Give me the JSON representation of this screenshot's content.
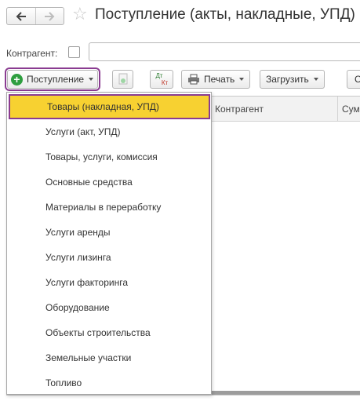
{
  "page": {
    "title": "Поступление (акты, накладные, УПД)"
  },
  "nav": {
    "back_icon": "arrow-left-icon",
    "forward_icon": "arrow-right-icon",
    "favorite_icon": "star-icon"
  },
  "filter": {
    "label": "Контрагент:",
    "value": ""
  },
  "toolbar": {
    "receipt_label": "Поступление",
    "print_label": "Печать",
    "load_label": "Загрузить",
    "dt_kt_top": "Дт",
    "dt_kt_bottom": "Кт",
    "more_label": "С"
  },
  "table": {
    "columns": [
      "Контрагент",
      "Сум"
    ]
  },
  "menu": {
    "items": [
      "Товары (накладная, УПД)",
      "Услуги (акт, УПД)",
      "Товары, услуги, комиссия",
      "Основные средства",
      "Материалы в переработку",
      "Услуги аренды",
      "Услуги лизинга",
      "Услуги факторинга",
      "Оборудование",
      "Объекты строительства",
      "Земельные участки",
      "Топливо"
    ],
    "selected_index": 0
  },
  "colors": {
    "accent_outline": "#8a3c91",
    "highlight": "#f7d131",
    "add_icon": "#2e9e3f"
  }
}
